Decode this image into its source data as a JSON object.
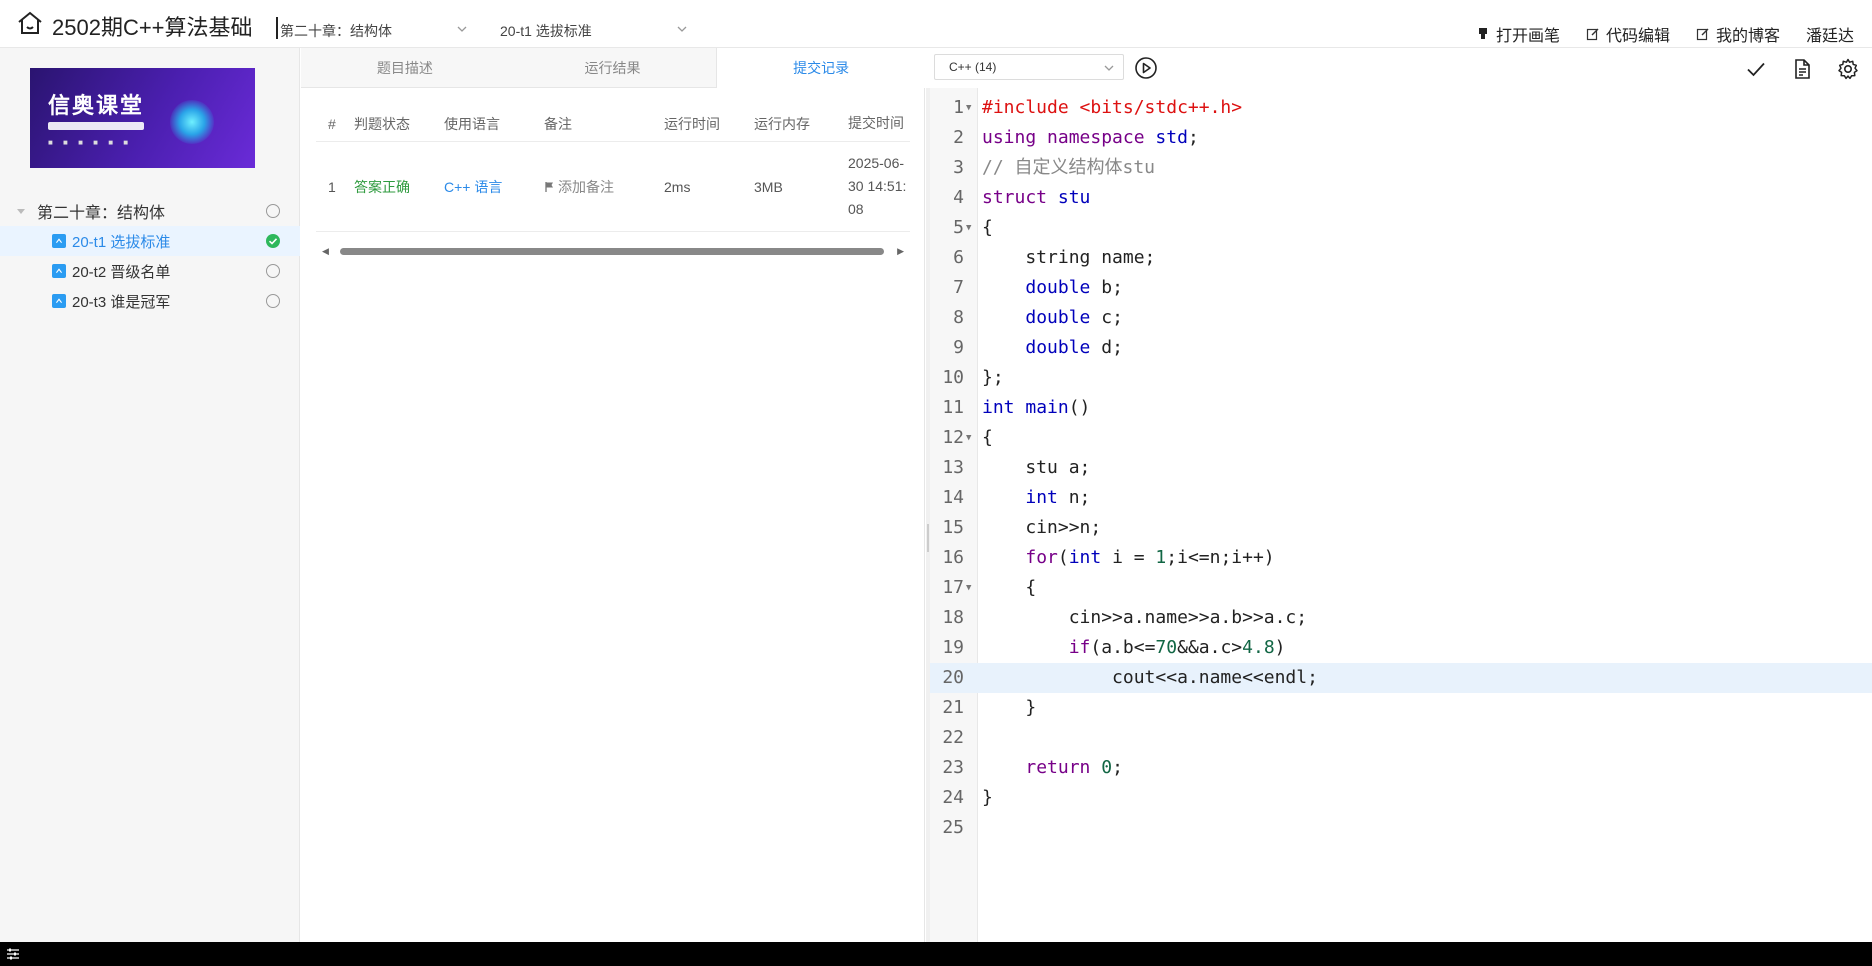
{
  "topbar": {
    "course_title": "2502期C++算法基础",
    "chapter_select": "第二十章：结构体",
    "problem_select": "20-t1 选拔标准",
    "actions": [
      {
        "label": "打开画笔",
        "icon": "marker-icon"
      },
      {
        "label": "代码编辑",
        "icon": "edit-icon"
      },
      {
        "label": "我的博客",
        "icon": "blog-edit-icon"
      }
    ],
    "user_name": "潘廷达"
  },
  "sidebar": {
    "banner_title": "信奥课堂",
    "chapter": {
      "label": "第二十章：结构体"
    },
    "items": [
      {
        "label": "20-t1 选拔标准",
        "active": true,
        "status": "accepted"
      },
      {
        "label": "20-t2 晋级名单",
        "active": false,
        "status": "not-attempted"
      },
      {
        "label": "20-t3 谁是冠军",
        "active": false,
        "status": "not-attempted"
      }
    ]
  },
  "tabs": {
    "description": "题目描述",
    "run_result": "运行结果",
    "submissions": "提交记录"
  },
  "submissions": {
    "headers": {
      "index": "#",
      "status": "判题状态",
      "language": "使用语言",
      "note": "备注",
      "time": "运行时间",
      "memory": "运行内存",
      "submitted": "提交时间"
    },
    "rows": [
      {
        "index": "1",
        "status": "答案正确",
        "language": "C++ 语言",
        "note": "添加备注",
        "time": "2ms",
        "memory": "3MB",
        "submitted": "2025-06-30 14:51:08"
      }
    ]
  },
  "editor": {
    "language": "C++ (14)",
    "highlight_line": 20,
    "lines": [
      {
        "n": "1",
        "fold": true
      },
      {
        "n": "2",
        "fold": false
      },
      {
        "n": "3",
        "fold": false
      },
      {
        "n": "4",
        "fold": false
      },
      {
        "n": "5",
        "fold": true
      },
      {
        "n": "6",
        "fold": false
      },
      {
        "n": "7",
        "fold": false
      },
      {
        "n": "8",
        "fold": false
      },
      {
        "n": "9",
        "fold": false
      },
      {
        "n": "10",
        "fold": false
      },
      {
        "n": "11",
        "fold": false
      },
      {
        "n": "12",
        "fold": true
      },
      {
        "n": "13",
        "fold": false
      },
      {
        "n": "14",
        "fold": false
      },
      {
        "n": "15",
        "fold": false
      },
      {
        "n": "16",
        "fold": false
      },
      {
        "n": "17",
        "fold": true
      },
      {
        "n": "18",
        "fold": false
      },
      {
        "n": "19",
        "fold": false
      },
      {
        "n": "20",
        "fold": false
      },
      {
        "n": "21",
        "fold": false
      },
      {
        "n": "22",
        "fold": false
      },
      {
        "n": "23",
        "fold": false
      },
      {
        "n": "24",
        "fold": false
      },
      {
        "n": "25",
        "fold": false
      }
    ],
    "code": [
      [
        {
          "t": "#include <bits/stdc++.h>",
          "c": "inc"
        }
      ],
      [
        {
          "t": "using",
          "c": "kw"
        },
        {
          "t": " "
        },
        {
          "t": "namespace",
          "c": "kw"
        },
        {
          "t": " "
        },
        {
          "t": "std",
          "c": "ty"
        },
        {
          "t": ";"
        }
      ],
      [
        {
          "t": "// 自定义结构体stu",
          "c": "cm"
        }
      ],
      [
        {
          "t": "struct",
          "c": "kw"
        },
        {
          "t": " "
        },
        {
          "t": "stu",
          "c": "fn"
        }
      ],
      [
        {
          "t": "{"
        }
      ],
      [
        {
          "t": "    string name;"
        }
      ],
      [
        {
          "t": "    "
        },
        {
          "t": "double",
          "c": "ty"
        },
        {
          "t": " b;"
        }
      ],
      [
        {
          "t": "    "
        },
        {
          "t": "double",
          "c": "ty"
        },
        {
          "t": " c;"
        }
      ],
      [
        {
          "t": "    "
        },
        {
          "t": "double",
          "c": "ty"
        },
        {
          "t": " d;"
        }
      ],
      [
        {
          "t": "};"
        }
      ],
      [
        {
          "t": "int",
          "c": "ty"
        },
        {
          "t": " "
        },
        {
          "t": "main",
          "c": "fn"
        },
        {
          "t": "()"
        }
      ],
      [
        {
          "t": "{"
        }
      ],
      [
        {
          "t": "    stu a;"
        }
      ],
      [
        {
          "t": "    "
        },
        {
          "t": "int",
          "c": "ty"
        },
        {
          "t": " n;"
        }
      ],
      [
        {
          "t": "    cin>>n;"
        }
      ],
      [
        {
          "t": "    "
        },
        {
          "t": "for",
          "c": "kw"
        },
        {
          "t": "("
        },
        {
          "t": "int",
          "c": "ty"
        },
        {
          "t": " i = "
        },
        {
          "t": "1",
          "c": "num"
        },
        {
          "t": ";i<=n;i++)"
        }
      ],
      [
        {
          "t": "    {"
        }
      ],
      [
        {
          "t": "        cin>>a.name>>a.b>>a.c;"
        }
      ],
      [
        {
          "t": "        "
        },
        {
          "t": "if",
          "c": "kw"
        },
        {
          "t": "(a.b<="
        },
        {
          "t": "70",
          "c": "num"
        },
        {
          "t": "&&a.c>"
        },
        {
          "t": "4.8",
          "c": "num"
        },
        {
          "t": ")"
        }
      ],
      [
        {
          "t": "            cout<<a.name<<endl;"
        }
      ],
      [
        {
          "t": "    }"
        }
      ],
      [
        {
          "t": ""
        }
      ],
      [
        {
          "t": "    "
        },
        {
          "t": "return",
          "c": "kw"
        },
        {
          "t": " "
        },
        {
          "t": "0",
          "c": "num"
        },
        {
          "t": ";"
        }
      ],
      [
        {
          "t": "}"
        }
      ],
      [
        {
          "t": ""
        }
      ]
    ]
  },
  "colors": {
    "accent": "#2b8ae8",
    "success": "#2eb85c",
    "keyword": "#770088",
    "type": "#0000bb",
    "include": "#dd1111",
    "comment": "#888888",
    "number": "#116644",
    "line_highlight": "#e8f2fc"
  }
}
